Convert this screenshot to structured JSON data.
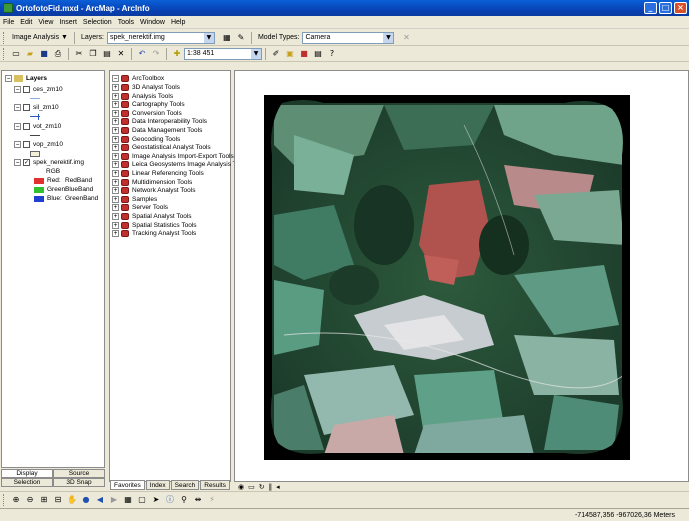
{
  "window": {
    "title": "OrtofotoFid.mxd - ArcMap - ArcInfo"
  },
  "menu": [
    "File",
    "Edit",
    "View",
    "Insert",
    "Selection",
    "Tools",
    "Window",
    "Help"
  ],
  "toolbar_image_analysis": {
    "dropdown": "Image Analysis",
    "layers_label": "Layers:",
    "layers_value": "spek_nerektif.img",
    "model_types_label": "Model Types:",
    "model_types_value": "Camera"
  },
  "standard_toolbar": {
    "scale": "1:38 451"
  },
  "toc": {
    "root": "Layers",
    "layers": [
      {
        "name": "ces_zm10",
        "checked": false
      },
      {
        "name": "sil_zm10",
        "checked": false
      },
      {
        "name": "vot_zm10",
        "checked": false
      },
      {
        "name": "vop_zm10",
        "checked": false
      },
      {
        "name": "spek_nerektif.img",
        "checked": true
      }
    ],
    "rgb_label": "RGB",
    "rgb": [
      {
        "label": "Red:",
        "band": "RedBand",
        "color": "#e03030"
      },
      {
        "label": "Green:",
        "band": "BlueBand",
        "color": "#30c030"
      },
      {
        "label": "Blue:",
        "band": "GreenBand",
        "color": "#2040d0"
      }
    ],
    "tabs": [
      "Display",
      "Source",
      "Selection",
      "3D Snap"
    ]
  },
  "arctoolbox": {
    "root": "ArcToolbox",
    "items": [
      "3D Analyst Tools",
      "Analysis Tools",
      "Cartography Tools",
      "Conversion Tools",
      "Data Interoperability Tools",
      "Data Management Tools",
      "Geocoding Tools",
      "Geostatistical Analyst Tools",
      "Image Analysis Import-Export Tools",
      "Leica Geosystems Image Analysis Too",
      "Linear Referencing Tools",
      "Multidimension Tools",
      "Network Analyst Tools",
      "Samples",
      "Server Tools",
      "Spatial Analyst Tools",
      "Spatial Statistics Tools",
      "Tracking Analyst Tools"
    ],
    "tabs": [
      "Favorites",
      "Index",
      "Search",
      "Results"
    ]
  },
  "status": {
    "coordinates": "-714587,356  -967026,36 Meters"
  }
}
